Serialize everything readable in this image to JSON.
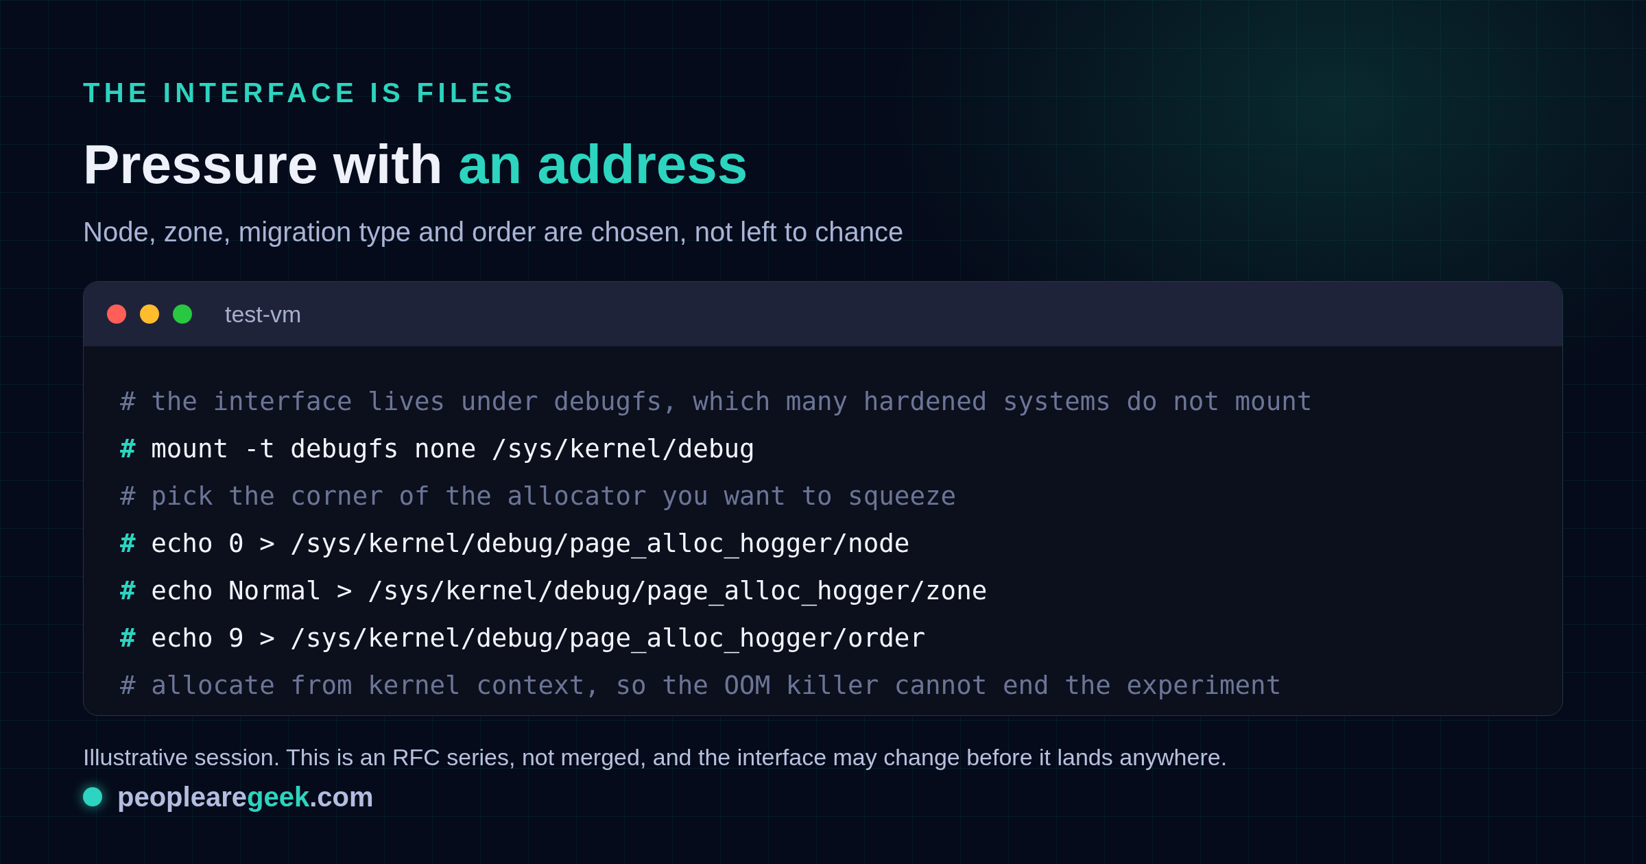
{
  "eyebrow": "THE INTERFACE IS FILES",
  "heading": {
    "text": "Pressure with",
    "highlight": "an address"
  },
  "subtitle": "Node, zone, migration type and order are chosen, not left to chance",
  "terminal": {
    "title": "test-vm",
    "lines": [
      {
        "kind": "comment",
        "text": "# the interface lives under debugfs, which many hardened systems do not mount"
      },
      {
        "kind": "command",
        "prompt": "#",
        "text": "mount -t debugfs none /sys/kernel/debug"
      },
      {
        "kind": "comment",
        "text": "# pick the corner of the allocator you want to squeeze"
      },
      {
        "kind": "command",
        "prompt": "#",
        "text": "echo 0 > /sys/kernel/debug/page_alloc_hogger/node"
      },
      {
        "kind": "command",
        "prompt": "#",
        "text": "echo Normal > /sys/kernel/debug/page_alloc_hogger/zone"
      },
      {
        "kind": "command",
        "prompt": "#",
        "text": "echo 9 > /sys/kernel/debug/page_alloc_hogger/order"
      },
      {
        "kind": "comment",
        "text": "# allocate from kernel context, so the OOM killer cannot end the experiment"
      }
    ]
  },
  "footnote": "Illustrative session. This is an RFC series, not merged, and the interface may change before it lands anywhere.",
  "brand": {
    "highlight": "geek",
    "after": ".com",
    "name": "peopleare"
  }
}
